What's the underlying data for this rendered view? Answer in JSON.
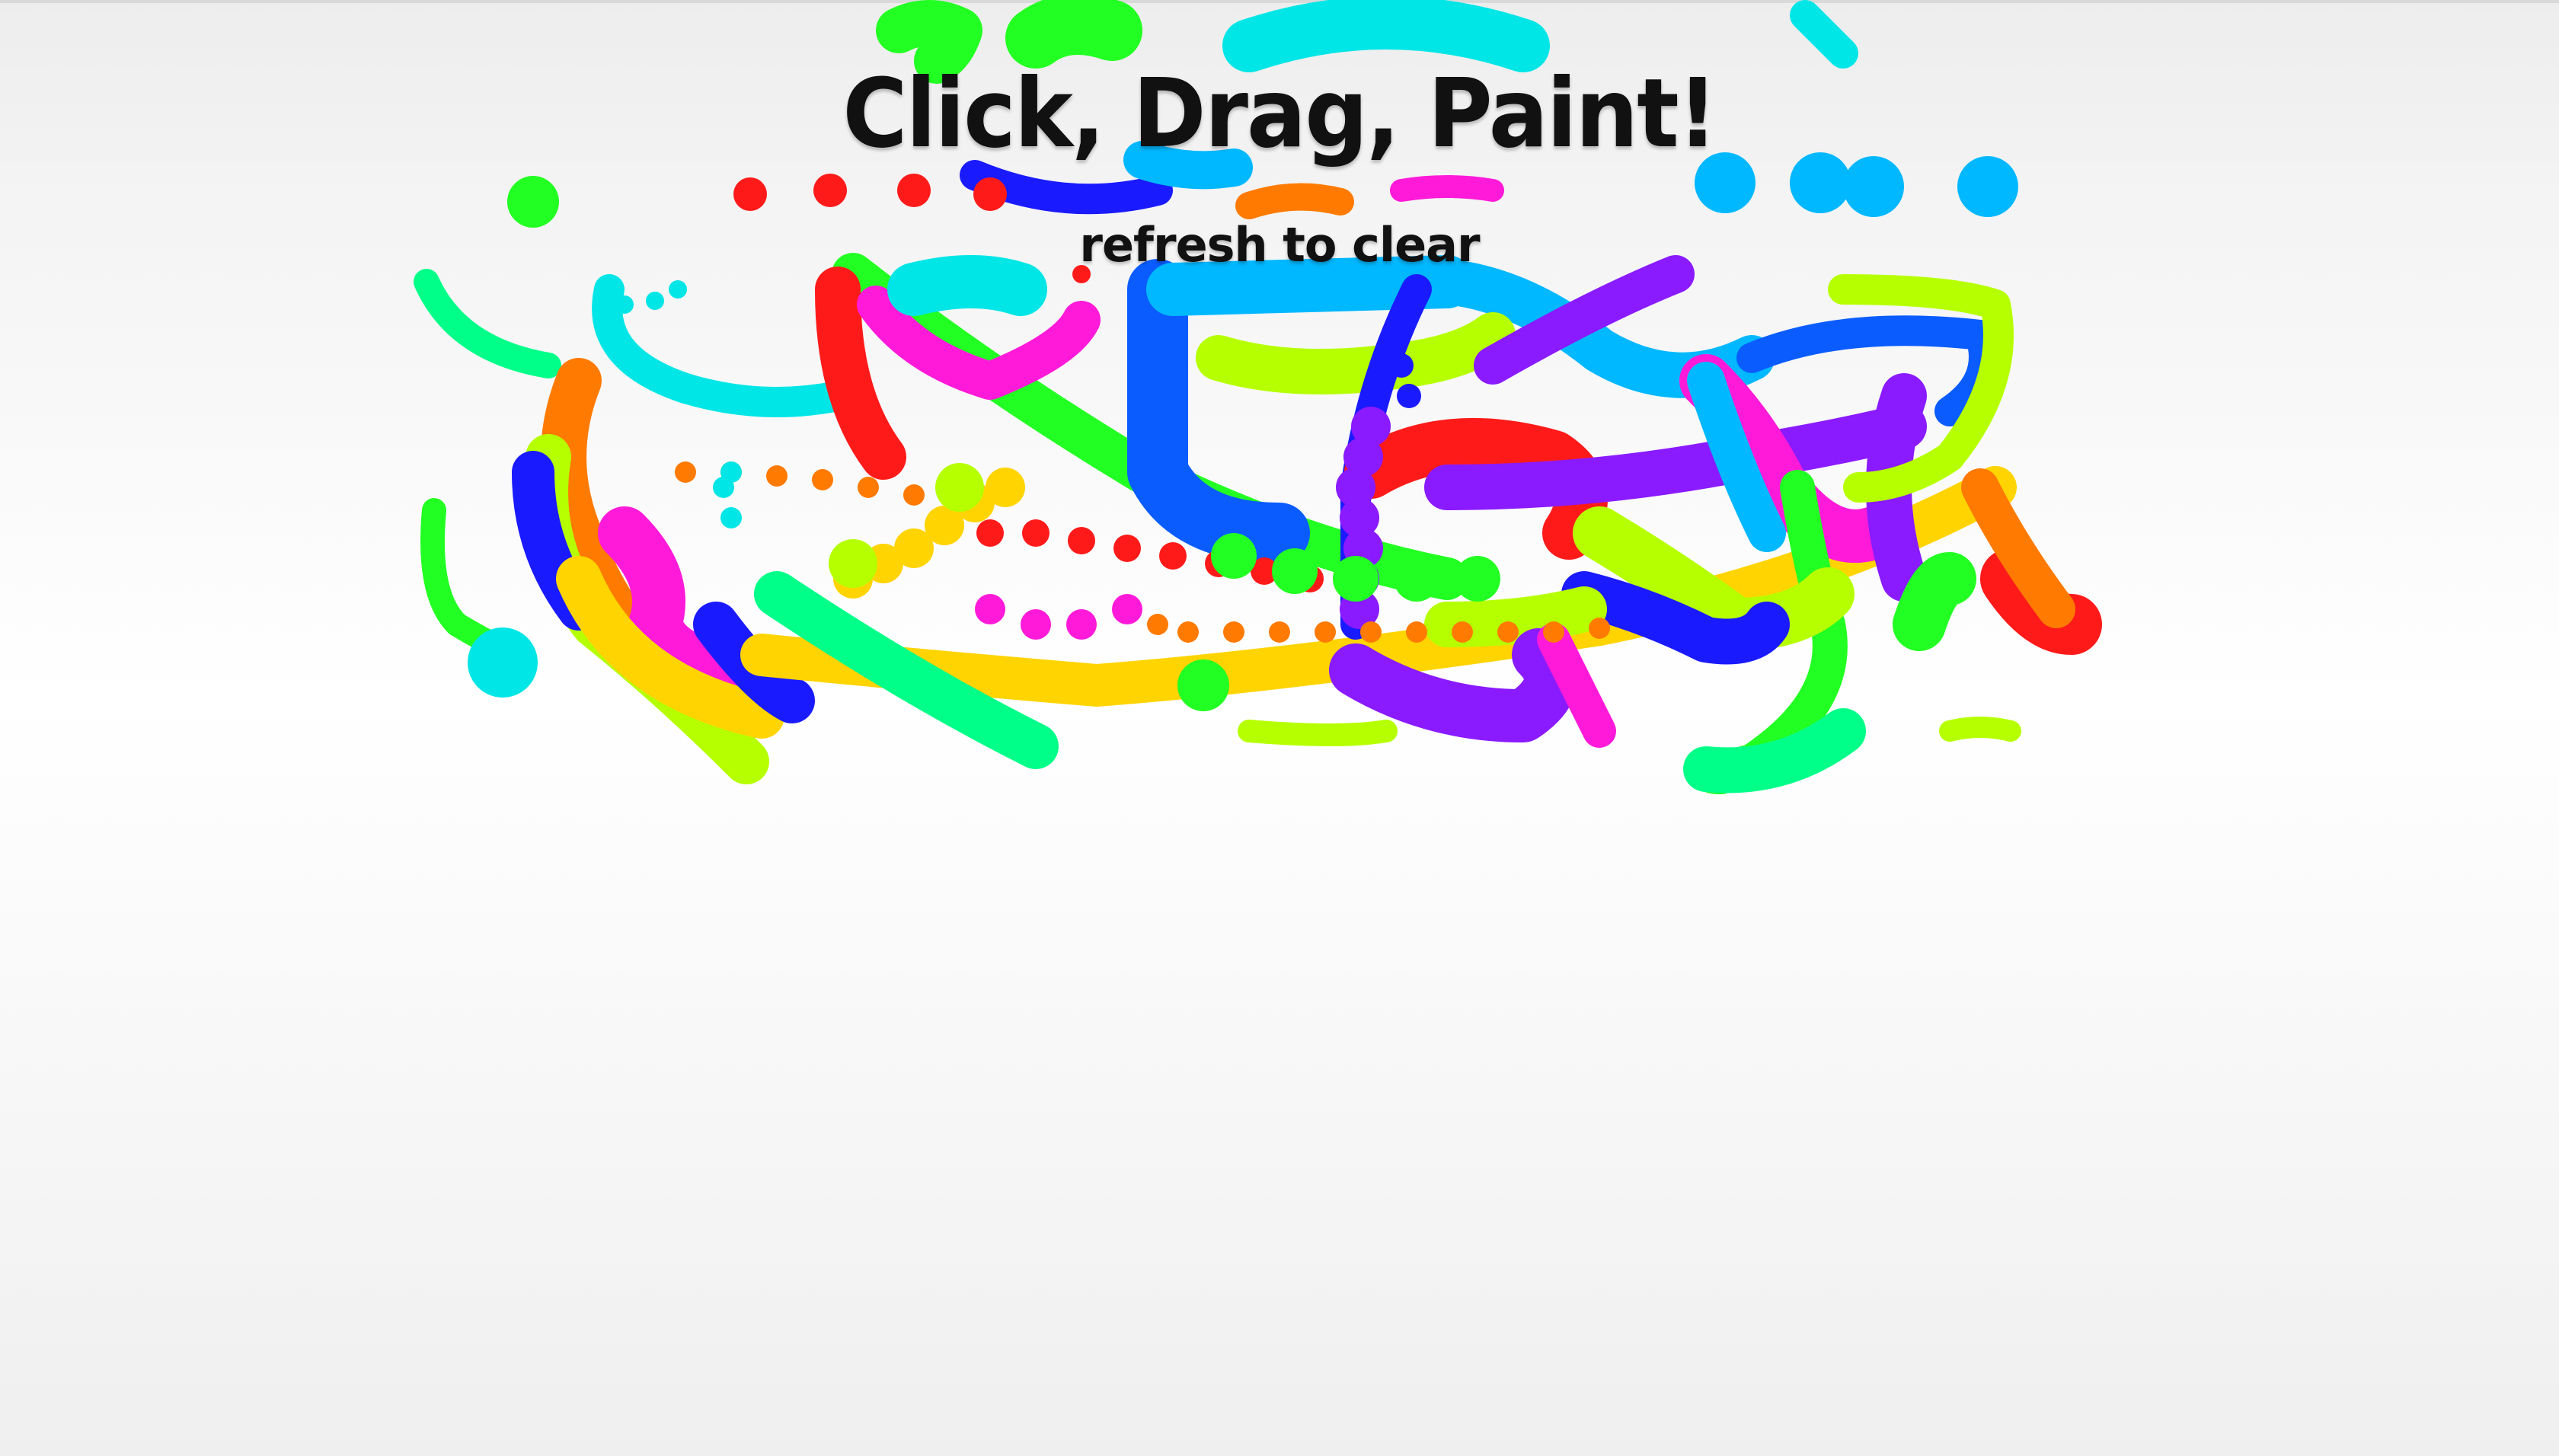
{
  "page": {
    "title": "Click, Drag, Paint!",
    "subtitle": "refresh to clear"
  },
  "canvas": {
    "background": "#ffffff",
    "palette": [
      "#ff1a1a",
      "#ff7a00",
      "#ffd400",
      "#b6ff00",
      "#22ff22",
      "#00ff88",
      "#00e6e6",
      "#00b8ff",
      "#0a5cff",
      "#1a1aff",
      "#8a1aff",
      "#ff1ad9",
      "#ff1a66"
    ]
  }
}
